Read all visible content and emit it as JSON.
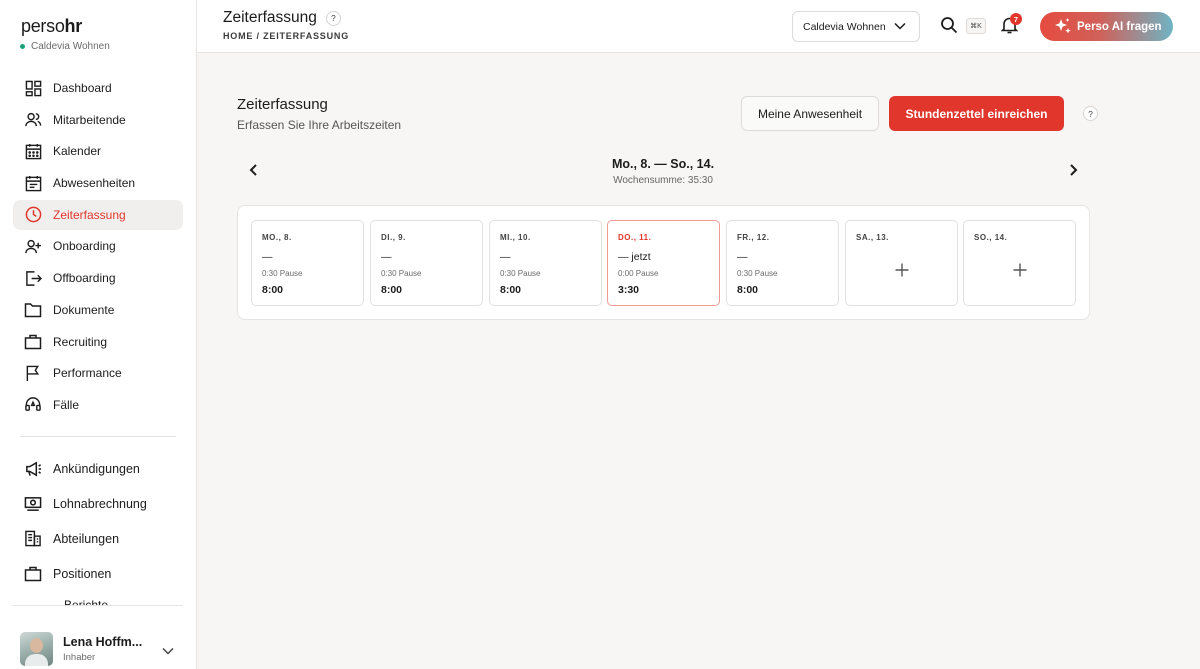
{
  "brand": {
    "part1": "perso",
    "part2": "hr"
  },
  "sidebar": {
    "company": "Caldevia Wohnen",
    "items": [
      {
        "label": "Dashboard",
        "icon": "dashboard-icon"
      },
      {
        "label": "Mitarbeitende",
        "icon": "users-icon"
      },
      {
        "label": "Kalender",
        "icon": "calendar-icon"
      },
      {
        "label": "Abwesenheiten",
        "icon": "absence-icon"
      },
      {
        "label": "Zeiterfassung",
        "icon": "clock-icon",
        "active": true
      },
      {
        "label": "Onboarding",
        "icon": "user-plus-icon"
      },
      {
        "label": "Offboarding",
        "icon": "logout-icon"
      },
      {
        "label": "Dokumente",
        "icon": "folder-icon"
      },
      {
        "label": "Recruiting",
        "icon": "briefcase-icon"
      },
      {
        "label": "Performance",
        "icon": "flag-icon"
      },
      {
        "label": "Fälle",
        "icon": "headset-icon"
      }
    ],
    "items2": [
      {
        "label": "Ankündigungen",
        "icon": "megaphone-icon"
      },
      {
        "label": "Lohnabrechnung",
        "icon": "payroll-icon"
      },
      {
        "label": "Abteilungen",
        "icon": "building-icon"
      },
      {
        "label": "Positionen",
        "icon": "briefcase-icon"
      }
    ],
    "cut_item": "Berichte",
    "user": {
      "name": "Lena Hoffm...",
      "role": "Inhaber"
    }
  },
  "topbar": {
    "title": "Zeiterfassung",
    "help": "?",
    "breadcrumb": "HOME / ZEITERFASSUNG",
    "company_select": "Caldevia Wohnen",
    "shortcut": "⌘K",
    "notifications": "7",
    "ai_button": "Perso AI fragen"
  },
  "main": {
    "title": "Zeiterfassung",
    "subtitle": "Erfassen Sie Ihre Arbeitszeiten",
    "btn_attendance": "Meine Anwesenheit",
    "btn_submit": "Stundenzettel einreichen",
    "help": "?",
    "week_range": "Mo., 8. — So., 14.",
    "week_sum": "Wochensumme: 35:30"
  },
  "days": [
    {
      "label": "MO., 8.",
      "time": "—",
      "pause": "0:30 Pause",
      "total": "8:00"
    },
    {
      "label": "DI., 9.",
      "time": "—",
      "pause": "0:30 Pause",
      "total": "8:00"
    },
    {
      "label": "MI., 10.",
      "time": "—",
      "pause": "0:30 Pause",
      "total": "8:00"
    },
    {
      "label": "DO., 11.",
      "time": "— jetzt",
      "pause": "0:00 Pause",
      "total": "3:30",
      "today": true
    },
    {
      "label": "FR., 12.",
      "time": "—",
      "pause": "0:30 Pause",
      "total": "8:00"
    },
    {
      "label": "SA., 13.",
      "empty": true
    },
    {
      "label": "SO., 14.",
      "empty": true
    }
  ],
  "colors": {
    "accent": "#e0362c",
    "active_bg": "#f1efee"
  }
}
